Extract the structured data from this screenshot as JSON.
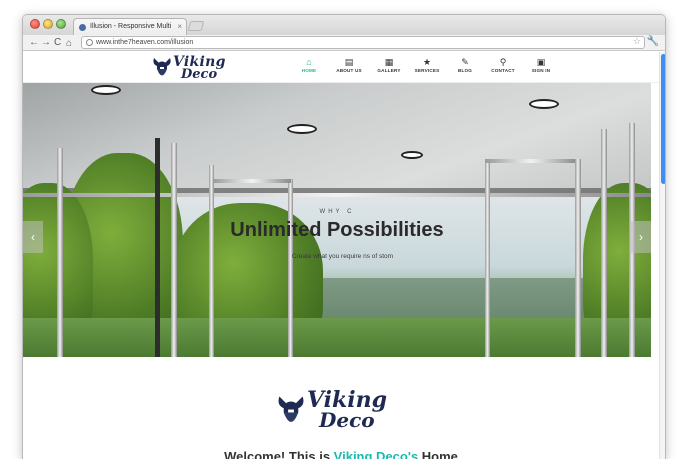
{
  "browser": {
    "tab_title": "Illusion - Responsive Multi",
    "tab_close": "×",
    "url": "www.inthe7heaven.com/illusion",
    "bookmark_icon": "star-icon",
    "menu_icon": "wrench-icon",
    "buttons": {
      "back": "←",
      "forward": "→",
      "reload": "C",
      "home": "⌂"
    }
  },
  "site": {
    "logo": {
      "line1": "Viking",
      "line2": "Deco"
    },
    "menu": [
      {
        "label": "HOME",
        "icon": "home-icon",
        "glyph": "⌂",
        "active": true
      },
      {
        "label": "ABOUT US",
        "icon": "document-icon",
        "glyph": "▤",
        "active": false
      },
      {
        "label": "GALLERY",
        "icon": "grid-icon",
        "glyph": "▦",
        "active": false
      },
      {
        "label": "SERVICES",
        "icon": "star-icon",
        "glyph": "★",
        "active": false
      },
      {
        "label": "BLOG",
        "icon": "pencil-icon",
        "glyph": "✎",
        "active": false
      },
      {
        "label": "CONTACT",
        "icon": "map-pin-icon",
        "glyph": "⚲",
        "active": false
      },
      {
        "label": "SIGN IN",
        "icon": "lock-icon",
        "glyph": "🔒",
        "active": false
      }
    ],
    "accent_color": "#21b88f"
  },
  "hero": {
    "kicker": "WHY C",
    "title": "Unlimited Possibilities",
    "subtitle": "Create what        you require                                  ns of           stom",
    "arrow_left": "‹",
    "arrow_right": "›"
  },
  "welcome": {
    "logo": {
      "line1": "Viking",
      "line2": "Deco"
    },
    "text_before": "Welcome! This is ",
    "text_accent": "Viking Deco's",
    "text_after": " Home"
  }
}
